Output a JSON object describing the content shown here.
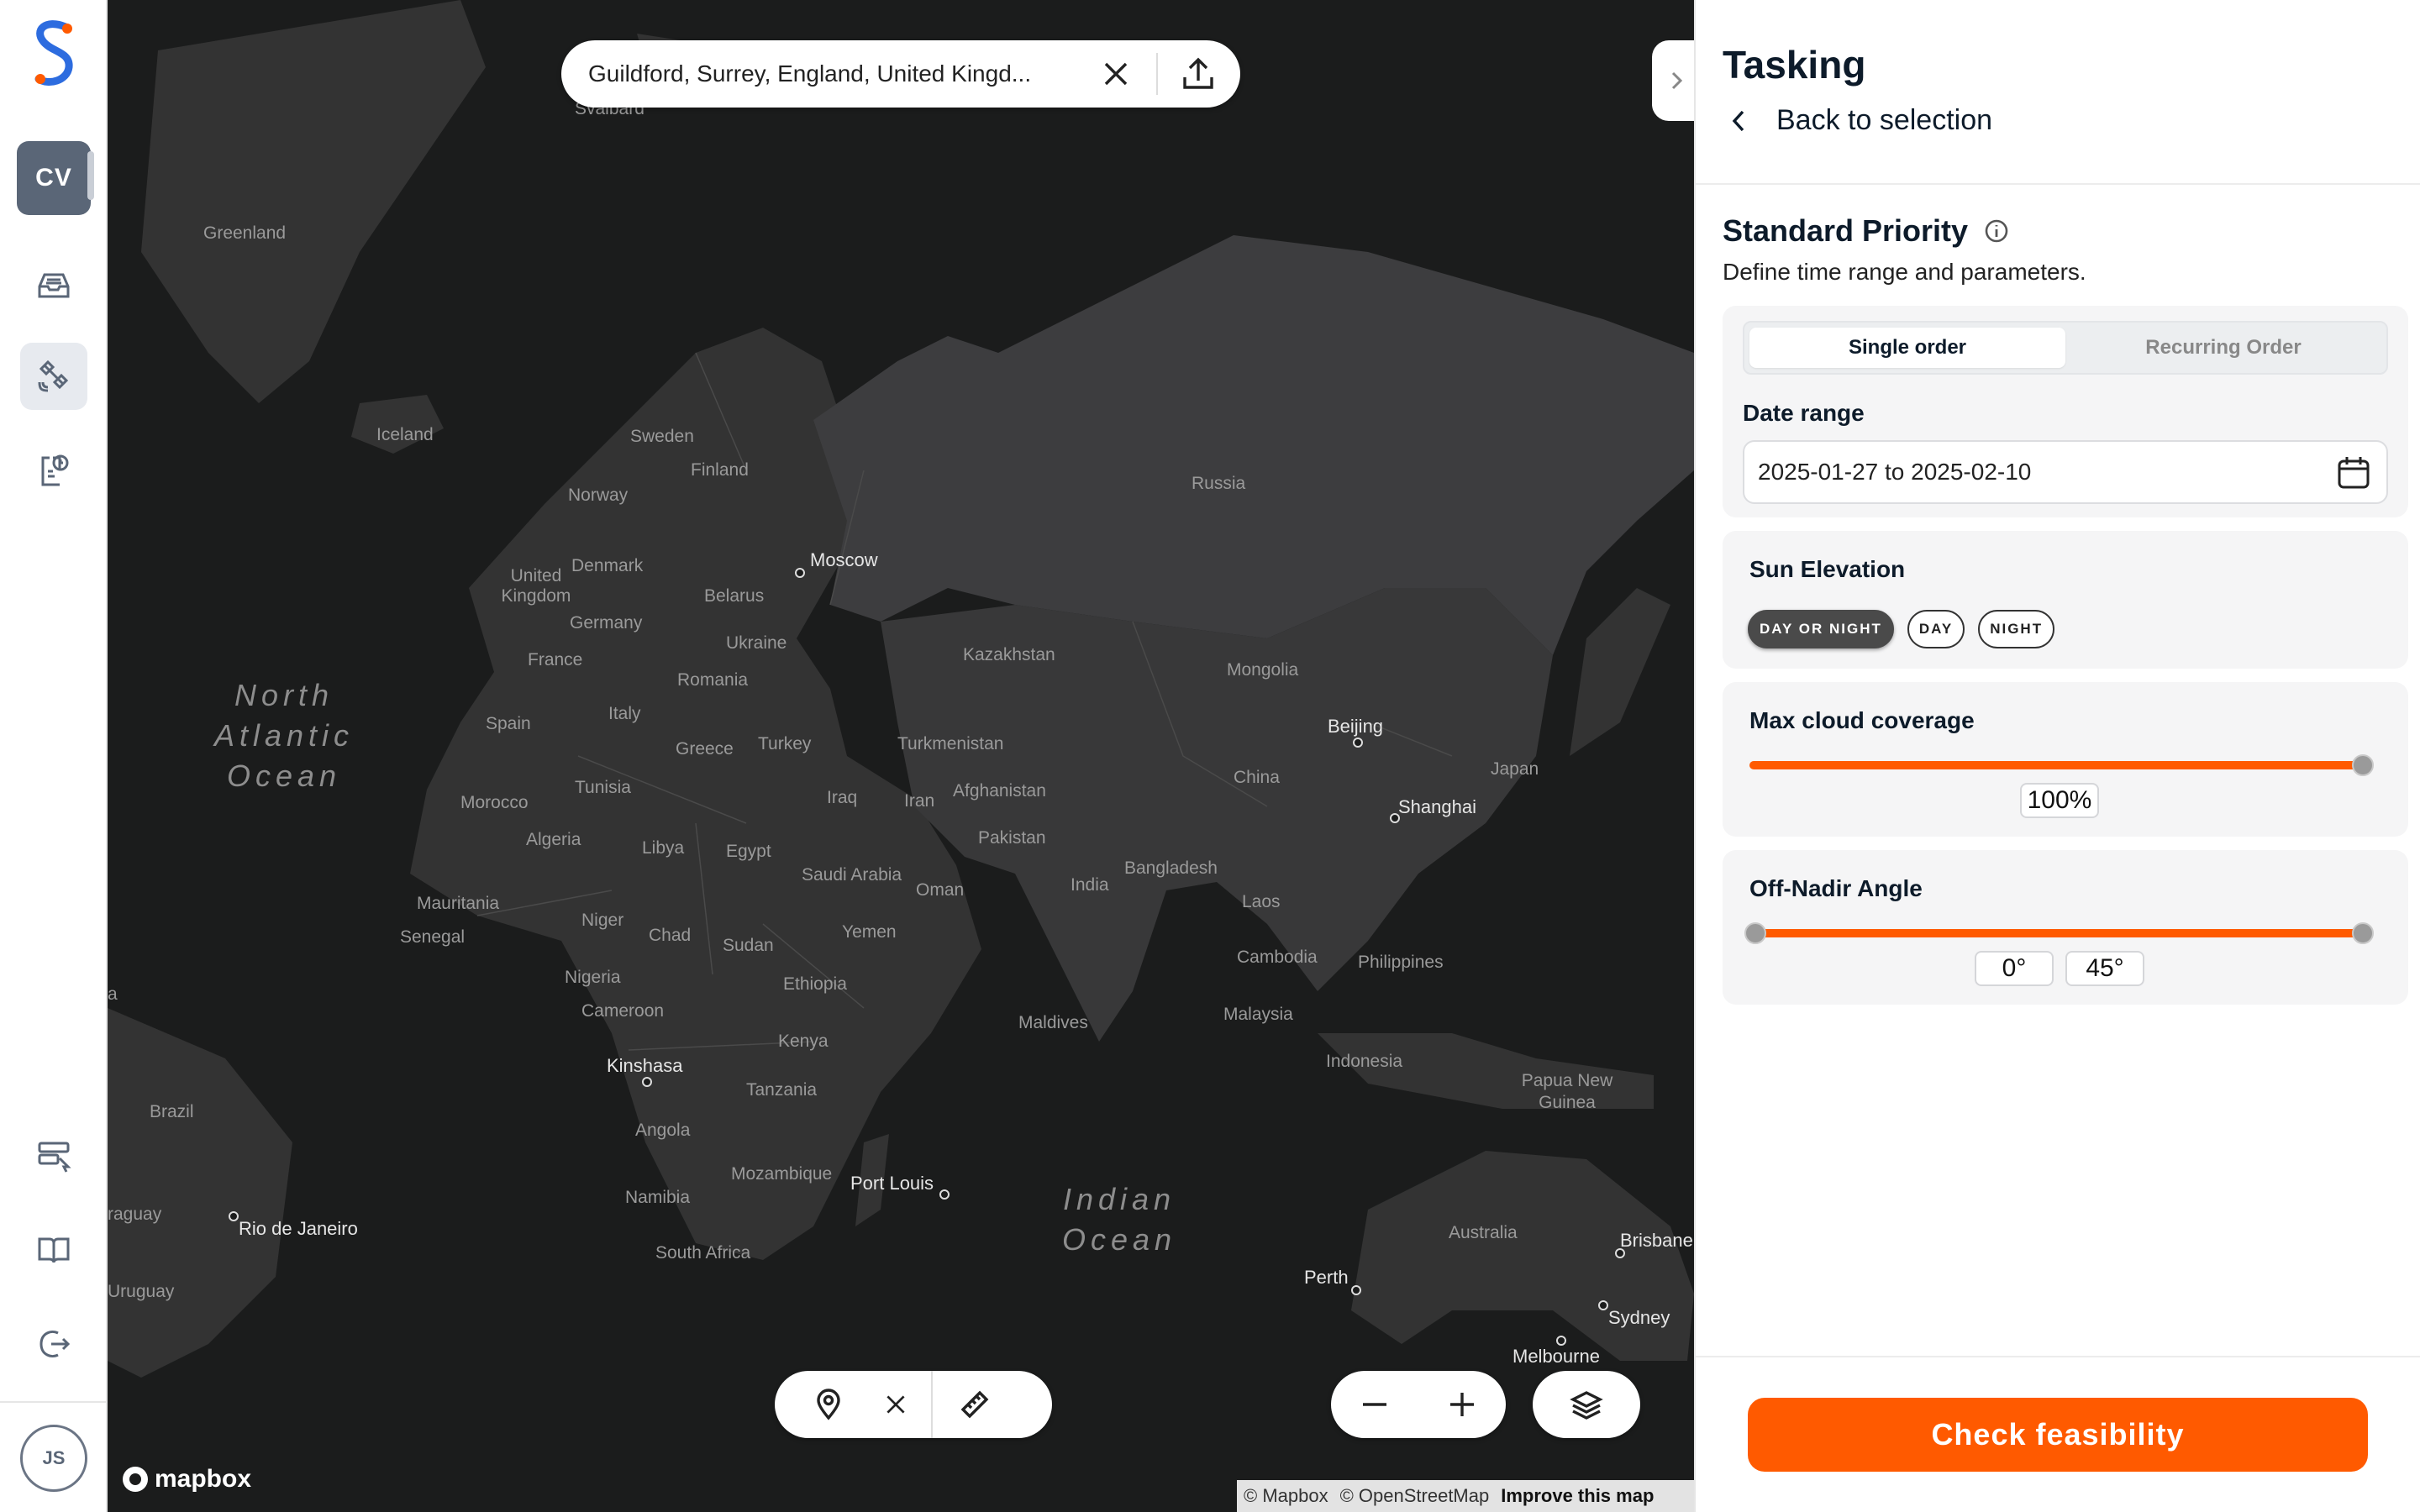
{
  "search": {
    "query": "Guildford, Surrey, England, United Kingd..."
  },
  "workspace": {
    "initials": "CV"
  },
  "user": {
    "initials": "JS"
  },
  "map": {
    "attribution": {
      "mapbox": "© Mapbox",
      "osm": "© OpenStreetMap",
      "improve": "Improve this map"
    },
    "logo_text": "mapbox",
    "labels": [
      "Svalbard",
      "Greenland",
      "Iceland",
      "Sweden",
      "Finland",
      "Norway",
      "Russia",
      "Moscow",
      "United Kingdom",
      "Denmark",
      "Belarus",
      "Germany",
      "Ukraine",
      "France",
      "Romania",
      "Kazakhstan",
      "Mongolia",
      "Spain",
      "Italy",
      "Greece",
      "Turkey",
      "Turkmenistan",
      "Beijing",
      "Japan",
      "Tunisia",
      "Morocco",
      "Iraq",
      "Iran",
      "Afghanistan",
      "China",
      "Shanghai",
      "Algeria",
      "Libya",
      "Egypt",
      "Pakistan",
      "Saudi Arabia",
      "Oman",
      "India",
      "Bangladesh",
      "Laos",
      "Mauritania",
      "Niger",
      "Chad",
      "Sudan",
      "Senegal",
      "Yemen",
      "Nigeria",
      "Ethiopia",
      "Cameroon",
      "Cambodia",
      "Philippines",
      "Maldives",
      "Malaysia",
      "Kenya",
      "Kinshasa",
      "Indonesia",
      "Tanzania",
      "Papua New Guinea",
      "Brazil",
      "Angola",
      "Mozambique",
      "Port Louis",
      "Namibia",
      "Australia",
      "Brisbane",
      "Rio de Janeiro",
      "South Africa",
      "Perth",
      "Sydney",
      "Melbourne",
      "raguay",
      "Uruguay",
      "a"
    ],
    "oceans": {
      "north_atlantic": [
        "North",
        "Atlantic",
        "Ocean"
      ],
      "indian": [
        "Indian",
        "Ocean"
      ]
    }
  },
  "panel": {
    "title": "Tasking",
    "back_label": "Back to selection",
    "priority_title": "Standard Priority",
    "priority_sub": "Define time range and parameters.",
    "order_tabs": [
      "Single order",
      "Recurring Order"
    ],
    "date_range": {
      "label": "Date range",
      "value": "2025-01-27 to 2025-02-10"
    },
    "sun_elevation": {
      "label": "Sun Elevation",
      "options": [
        "DAY OR NIGHT",
        "DAY",
        "NIGHT"
      ],
      "selected": "DAY OR NIGHT"
    },
    "cloud": {
      "label": "Max cloud coverage",
      "value": "100%",
      "fraction": 1.0
    },
    "off_nadir": {
      "label": "Off-Nadir Angle",
      "min": "0°",
      "max": "45°",
      "min_fraction": 0.0,
      "max_fraction": 1.0
    },
    "cta": "Check feasibility"
  },
  "colors": {
    "accent": "#ff5a00",
    "map_bg": "#1b1c1c",
    "land": "#333333",
    "russia": "#3d3d3f"
  }
}
